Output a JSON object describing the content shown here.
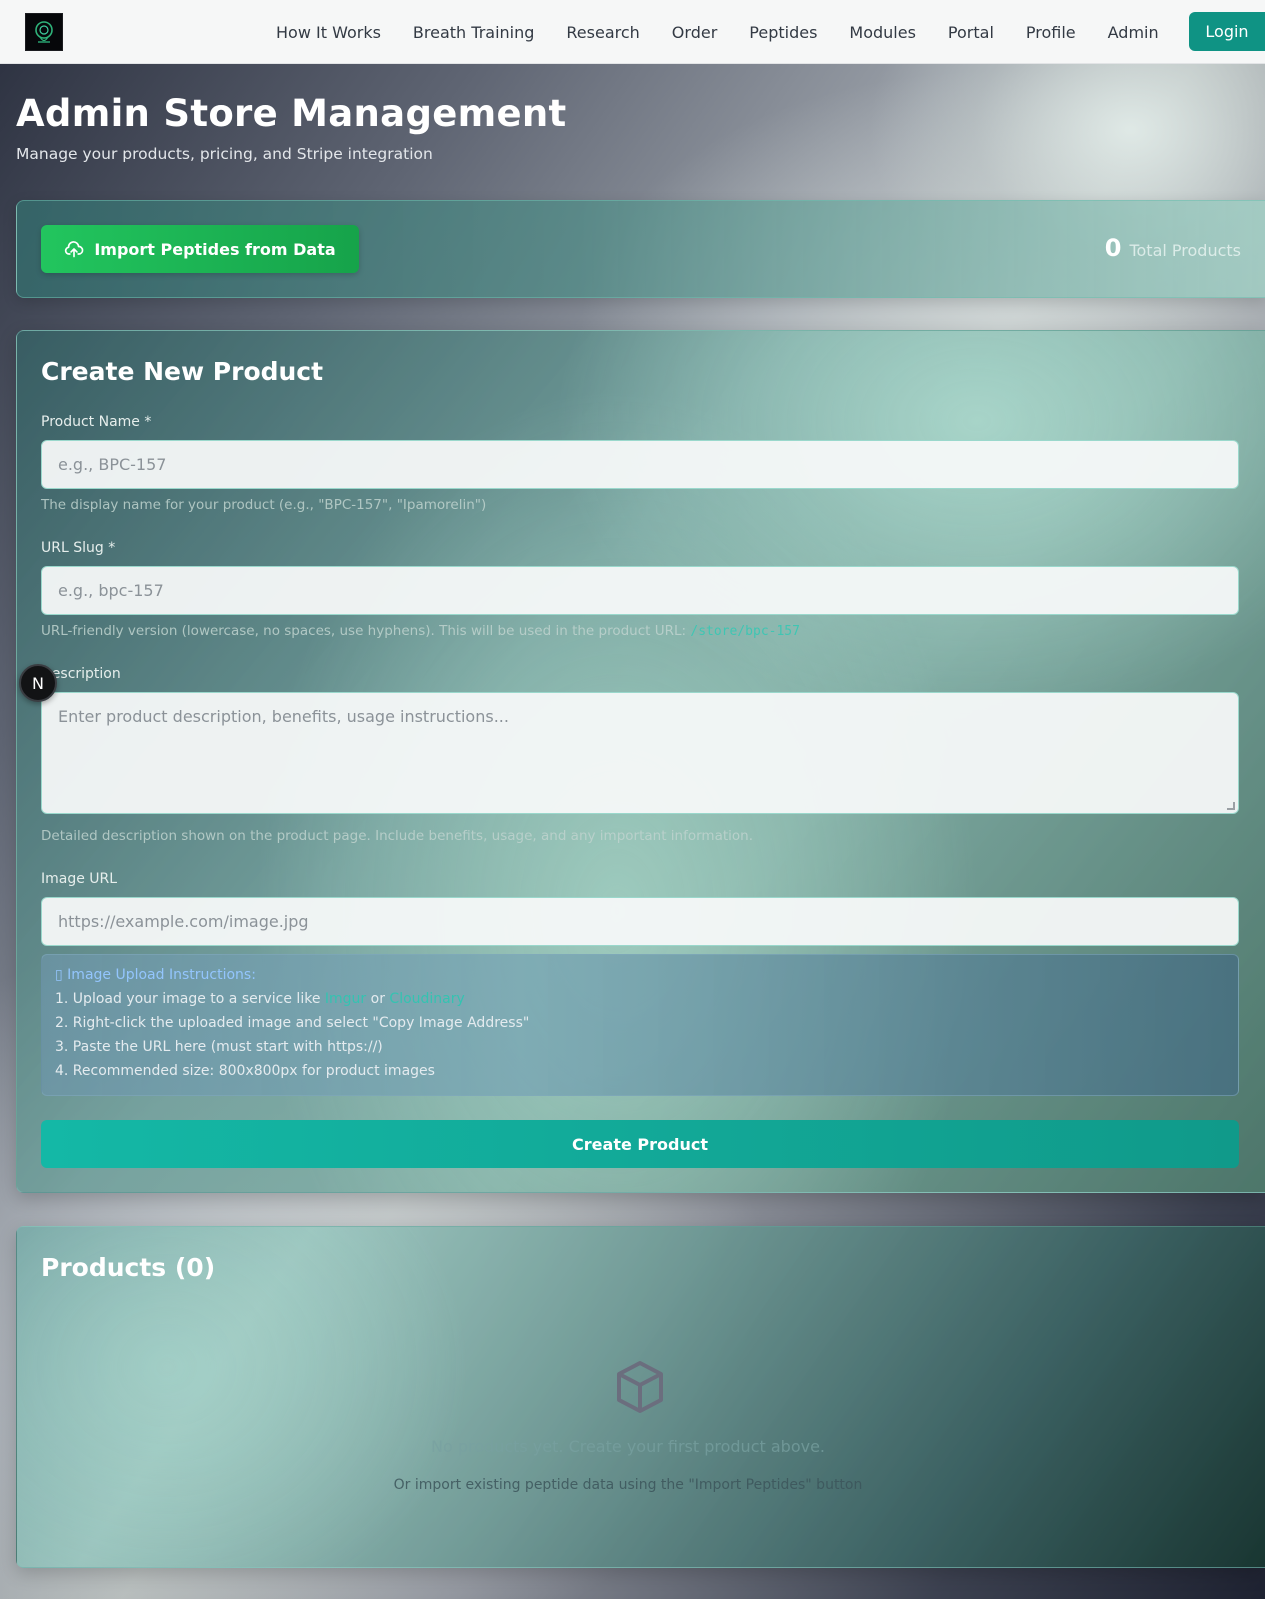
{
  "nav": {
    "links": [
      "How It Works",
      "Breath Training",
      "Research",
      "Order",
      "Peptides",
      "Modules",
      "Portal",
      "Profile",
      "Admin"
    ],
    "login_label": "Login"
  },
  "header": {
    "title": "Admin Store Management",
    "subtitle": "Manage your products, pricing, and Stripe integration"
  },
  "import_panel": {
    "button_label": "Import Peptides from Data",
    "total_count": "0",
    "total_label": "Total Products"
  },
  "form": {
    "title": "Create New Product",
    "product_name": {
      "label": "Product Name *",
      "placeholder": "e.g., BPC-157",
      "help": "The display name for your product (e.g., \"BPC-157\", \"Ipamorelin\")"
    },
    "url_slug": {
      "label": "URL Slug *",
      "placeholder": "e.g., bpc-157",
      "help": "URL-friendly version (lowercase, no spaces, use hyphens). This will be used in the product URL:",
      "help_code": "/store/bpc-157"
    },
    "description": {
      "label": "Description",
      "placeholder": "Enter product description, benefits, usage instructions...",
      "help": "Detailed description shown on the product page. Include benefits, usage, and any important information."
    },
    "image_url": {
      "label": "Image URL",
      "placeholder": "https://example.com/image.jpg"
    },
    "instructions": {
      "title": "Image Upload Instructions:",
      "line1_prefix": "1. Upload your image to a service like",
      "line1_link1": "Imgur",
      "line1_or": "or",
      "line1_link2": "Cloudinary",
      "line2": "2. Right-click the uploaded image and select \"Copy Image Address\"",
      "line3": "3. Paste the URL here (must start with https://)",
      "line4": "4. Recommended size: 800x800px for product images"
    },
    "submit_label": "Create Product"
  },
  "products": {
    "title": "Products (0)",
    "empty_main": "No products yet. Create your first product above.",
    "empty_sub": "Or import existing peptide data using the \"Import Peptides\" button"
  },
  "overlay": {
    "badge_letter": "N"
  },
  "colors": {
    "accent": "#0f9384",
    "import_button": "#22c55e",
    "create_button": "#14b8a6",
    "instructions_title": "#93c5fd"
  }
}
